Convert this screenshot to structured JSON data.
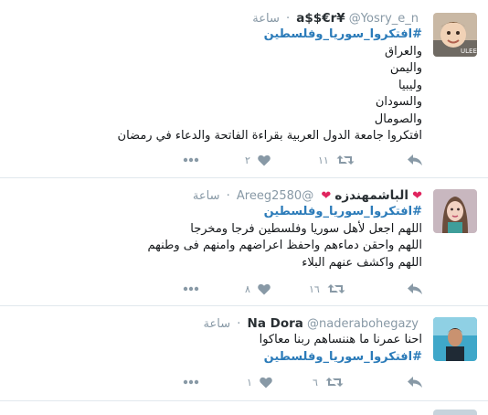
{
  "tweets": [
    {
      "fullname": "a$$€r¥",
      "handle": "@Yosry_e_n",
      "time": "ساعة",
      "lines": [
        "#افتكروا_سوريا_وفلسطين",
        "والعراق",
        "واليمن",
        "وليبيا",
        "والسودان",
        "والصومال",
        "افتكروا جامعة الدول العربية بقراءة الفاتحة والدعاء في رمضان"
      ],
      "retweets": "١١",
      "likes": "٢"
    },
    {
      "fullname": "الباشمهندزه",
      "handle": "@Areeg2580",
      "time": "ساعة",
      "lines": [
        "#افتكروا_سوريا_وفلسطين",
        "اللهم اجعل لأهل سوريا وفلسطين فرجا ومخرجا",
        "اللهم واحقن دماءهم واحفظ اعراضهم وامنهم فى وطنهم",
        "اللهم واكشف عنهم البلاء"
      ],
      "retweets": "١٦",
      "likes": "٨"
    },
    {
      "fullname": "Na Dora",
      "handle": "@naderabohegazy",
      "time": "ساعة",
      "lines": [
        "احنا عمرنا ما هننساهم ربنا معاكوا",
        "#افتكروا_سوريا_وفلسطين"
      ],
      "retweets": "٦",
      "likes": "١"
    }
  ],
  "colors": {
    "hashtag": "#2b7bb9",
    "meta": "#8899a6",
    "text": "#14171a",
    "heart_red": "#e0245e"
  }
}
